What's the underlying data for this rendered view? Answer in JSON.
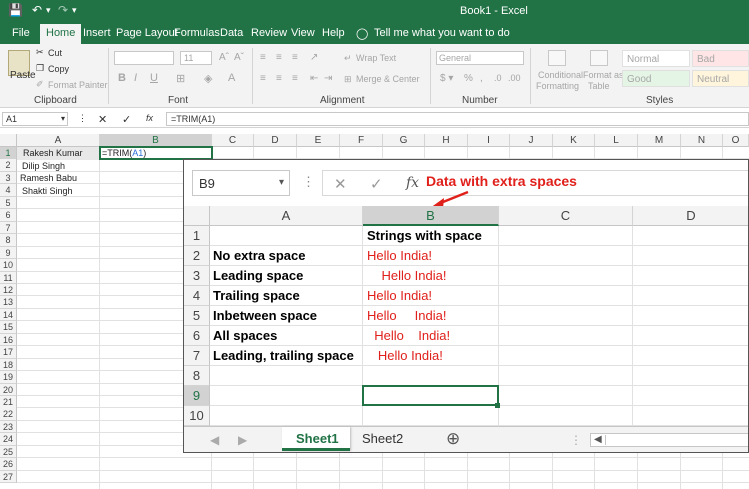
{
  "titlebar": {
    "title": "Book1  -  Excel",
    "bg": "#217346"
  },
  "tabs": [
    "File",
    "Home",
    "Insert",
    "Page Layout",
    "Formulas",
    "Data",
    "Review",
    "View",
    "Help"
  ],
  "tell_me": "Tell me what you want to do",
  "ribbon": {
    "clipboard": {
      "paste": "Paste",
      "cut": "Cut",
      "copy": "Copy",
      "format_painter": "Format Painter",
      "label": "Clipboard"
    },
    "font": {
      "size": "11",
      "bold": "B",
      "italic": "I",
      "underline": "U",
      "label": "Font"
    },
    "alignment": {
      "wrap_text": "Wrap Text",
      "merge_center": "Merge & Center",
      "label": "Alignment"
    },
    "number": {
      "format": "General",
      "label": "Number"
    },
    "styles": {
      "conditional_1": "Conditional",
      "conditional_2": "Formatting",
      "format_as_1": "Format as",
      "format_as_2": "Table",
      "normal": "Normal",
      "bad": "Bad",
      "good": "Good",
      "neutral": "Neutral",
      "label": "Styles"
    }
  },
  "formula_bar": {
    "name_box": "A1",
    "fx": "fx",
    "formula": "=TRIM(A1)"
  },
  "back_sheet": {
    "columns": [
      "A",
      "B",
      "C",
      "D",
      "E",
      "F",
      "G",
      "H",
      "I",
      "J",
      "K",
      "L",
      "M",
      "N",
      "O"
    ],
    "rows": [
      "1",
      "2",
      "3",
      "4",
      "5",
      "6",
      "7",
      "8",
      "9",
      "10",
      "11",
      "12",
      "13",
      "14",
      "15",
      "16",
      "17",
      "18",
      "19",
      "20",
      "21",
      "22",
      "23",
      "24",
      "25",
      "26",
      "27"
    ],
    "a1": "Rakesh Kumar",
    "a2": "Dilip Singh",
    "a3": "Ramesh Babu",
    "a4": "Shakti Singh",
    "b1_prefix": "=TRIM(",
    "b1_ref": "A1",
    "b1_suffix": ")"
  },
  "zoom_view": {
    "name_box": "B9",
    "fx": "fx",
    "annotation": "Data with extra spaces",
    "columns": [
      "A",
      "B",
      "C",
      "D"
    ],
    "rows": [
      "1",
      "2",
      "3",
      "4",
      "5",
      "6",
      "7",
      "8",
      "9",
      "10"
    ],
    "a": [
      "",
      "No extra space",
      "Leading space",
      "Trailing space",
      "Inbetween space",
      "All spaces",
      "Leading, trailing space",
      "",
      "",
      ""
    ],
    "b": [
      "Strings with space",
      "Hello India!",
      "    Hello India!",
      "Hello India!",
      "Hello     India!",
      "  Hello    India!",
      "   Hello India!",
      "",
      "",
      ""
    ],
    "sheet_tabs": [
      "Sheet1",
      "Sheet2"
    ],
    "accent": "#217346",
    "text_red": "#e0201b"
  }
}
